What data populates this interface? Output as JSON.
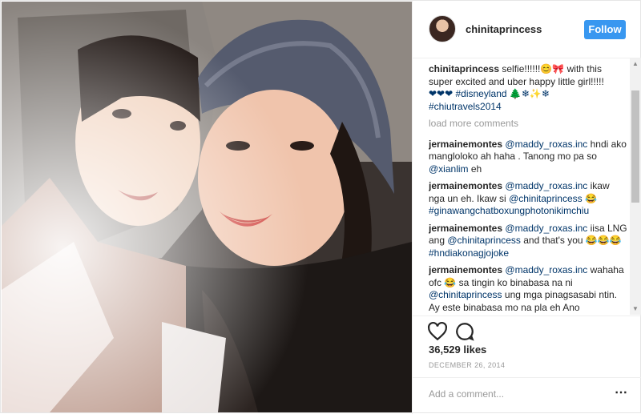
{
  "post": {
    "username": "chinitaprincess",
    "follow_label": "Follow",
    "caption": {
      "user": "chinitaprincess",
      "text": "selfie!!!!!!😊🎀 with this super excited and uber happy little girl!!!!!",
      "line2": "❤❤❤ #disneyland 🌲❄✨❄",
      "hashtag": "#chiutravels2014"
    },
    "load_more": "load more comments",
    "comments": [
      {
        "user": "jermainemontes",
        "parts": [
          "@maddy_roxas.inc",
          " hndi ako mangloloko ah haha . Tanong mo pa so ",
          "@xianlim",
          " eh"
        ]
      },
      {
        "user": "jermainemontes",
        "parts": [
          "@maddy_roxas.inc",
          " ikaw nga un eh. Ikaw si ",
          "@chinitaprincess",
          " 😂 ",
          "#ginawangchatboxungphotonikimchiu",
          ""
        ]
      },
      {
        "user": "jermainemontes",
        "parts": [
          "@maddy_roxas.inc",
          " iisa LNG ang ",
          "@chinitaprincess",
          " and that's you 😂😂😂 ",
          "#hndiakonagjojoke",
          ""
        ]
      },
      {
        "user": "jermainemontes",
        "parts": [
          "@maddy_roxas.inc",
          " wahaha ofc 😂 sa tingin ko binabasa na ni ",
          "@chinitaprincess",
          " ung mga pinagsasabi ntin. Ay este binabasa mo na pla eh Ano",
          "",
          ""
        ]
      }
    ],
    "likes": "36,529 likes",
    "date": "DECEMBER 26, 2014",
    "add_comment_placeholder": "Add a comment...",
    "more_icon": "⋯",
    "icons": [
      "heart-icon",
      "comment-icon",
      "more-icon"
    ],
    "colors": {
      "follow": "#3897f0",
      "link": "#003569",
      "muted": "#999999"
    }
  }
}
